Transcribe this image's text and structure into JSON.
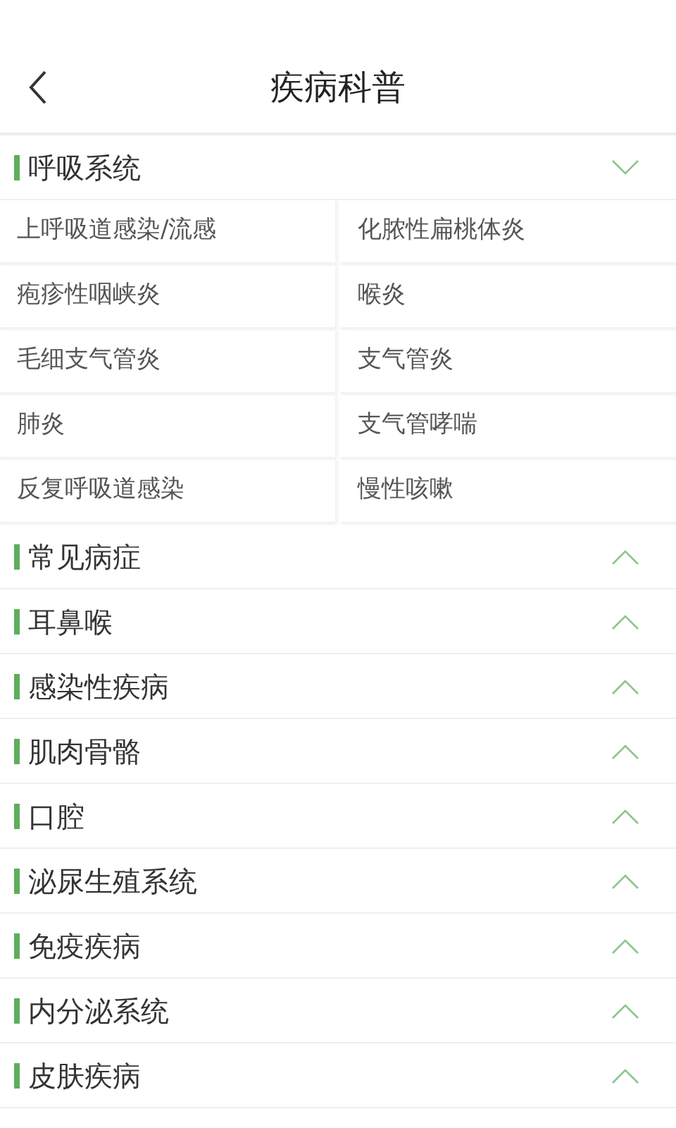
{
  "header": {
    "title": "疾病科普"
  },
  "sections": [
    {
      "title": "呼吸系统",
      "expanded": true,
      "items": [
        "上呼吸道感染/流感",
        "化脓性扁桃体炎",
        "疱疹性咽峡炎",
        "喉炎",
        "毛细支气管炎",
        "支气管炎",
        "肺炎",
        "支气管哮喘",
        "反复呼吸道感染",
        "慢性咳嗽"
      ]
    },
    {
      "title": "常见病症",
      "expanded": false
    },
    {
      "title": "耳鼻喉",
      "expanded": false
    },
    {
      "title": "感染性疾病",
      "expanded": false
    },
    {
      "title": "肌肉骨骼",
      "expanded": false
    },
    {
      "title": "口腔",
      "expanded": false
    },
    {
      "title": "泌尿生殖系统",
      "expanded": false
    },
    {
      "title": "免疫疾病",
      "expanded": false
    },
    {
      "title": "内分泌系统",
      "expanded": false
    },
    {
      "title": "皮肤疾病",
      "expanded": false
    }
  ]
}
